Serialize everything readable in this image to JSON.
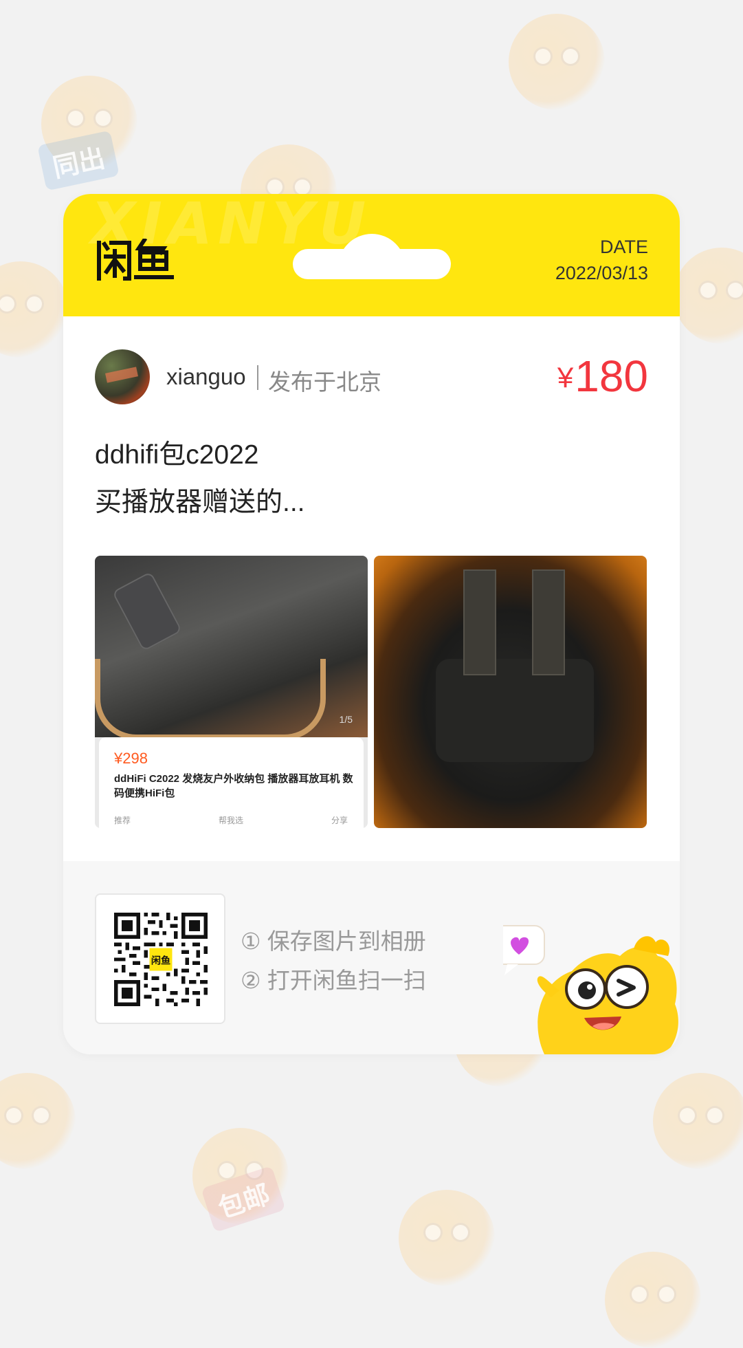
{
  "header": {
    "logo_text": "闲鱼",
    "watermark": "XIANYU",
    "date_label": "DATE",
    "date_value": "2022/03/13"
  },
  "seller": {
    "username": "xianguo",
    "location": "发布于北京"
  },
  "listing": {
    "price_symbol": "¥",
    "price": "180",
    "description_line1": "ddhifi包c2022",
    "description_line2": "买播放器赠送的..."
  },
  "photos": [
    {
      "counter": "1/5",
      "price": "¥298",
      "title": "ddHiFi C2022 发烧友户外收纳包 播放器耳放耳机 数码便携HiFi包",
      "actions": [
        "推荐",
        "帮我选",
        "分享"
      ]
    },
    {}
  ],
  "footer": {
    "step1": "① 保存图片到相册",
    "step2": "② 打开闲鱼扫一扫",
    "qr_center": "闲鱼"
  },
  "background_tags": [
    "同出",
    "包邮"
  ],
  "colors": {
    "brand_yellow": "#ffe60f",
    "price_red": "#f2363e",
    "background": "#f2f2f2"
  },
  "icons": [
    "xianyu-logo-icon",
    "qr-code-icon",
    "heart-bubble-icon",
    "mascot-fish-icon"
  ]
}
